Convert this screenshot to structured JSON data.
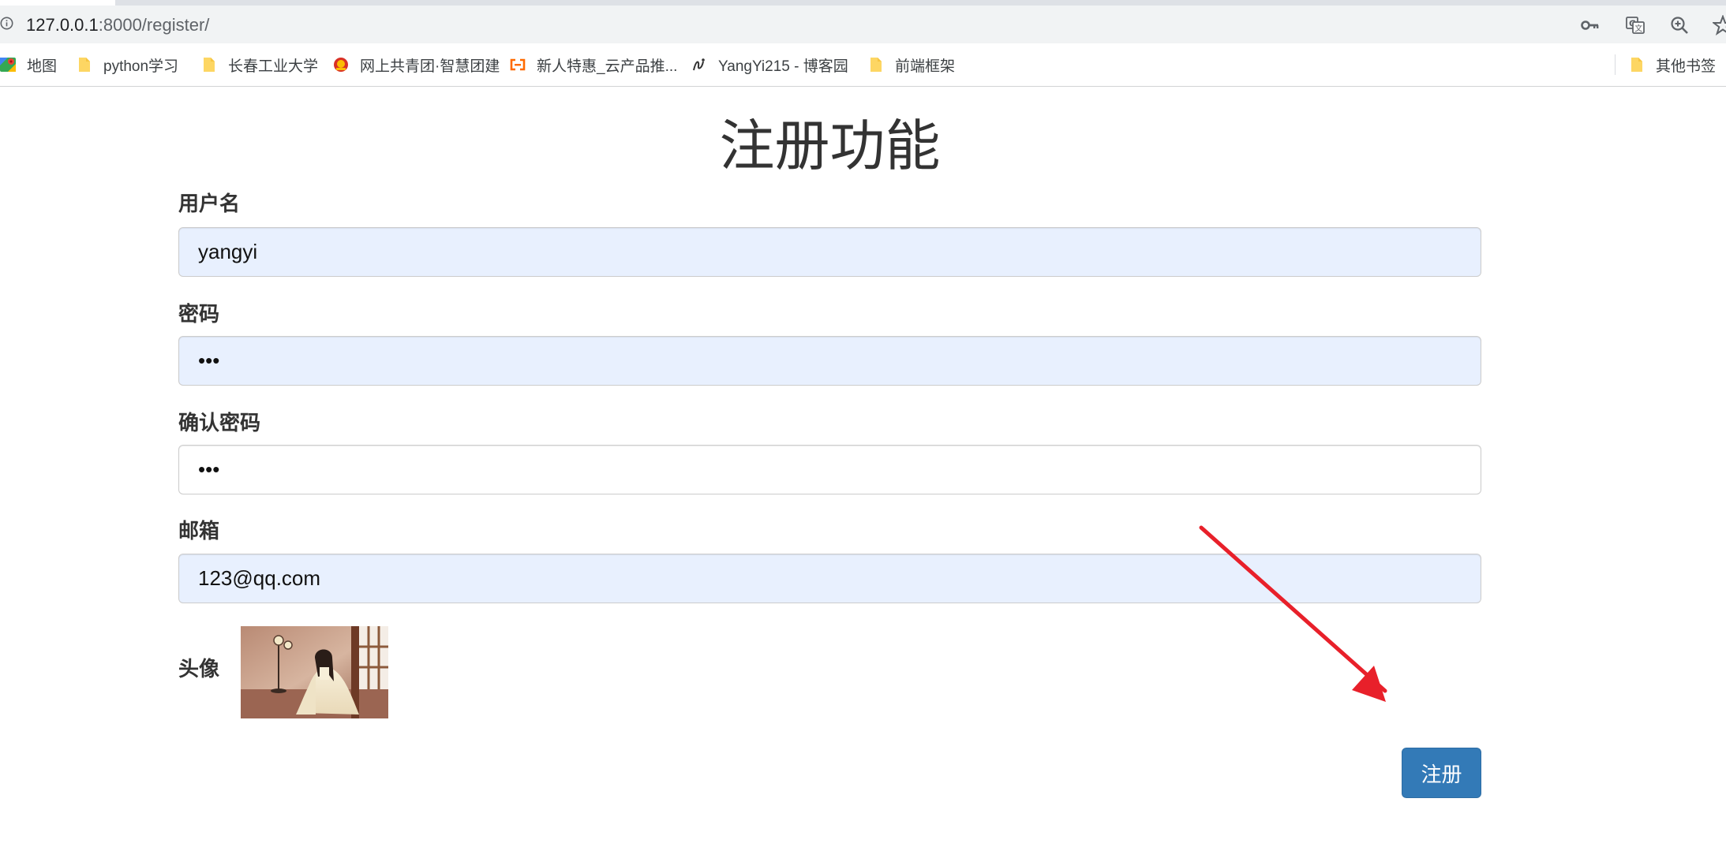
{
  "browser": {
    "url_host": "127.0.0.1",
    "url_rest": ":8000/register/",
    "addressbar_icons": [
      "key-icon",
      "translate-icon",
      "zoom-icon",
      "star-icon"
    ]
  },
  "bookmarks": [
    {
      "label": "地图",
      "icon": "maps-icon"
    },
    {
      "label": "python学习",
      "icon": "folder-icon"
    },
    {
      "label": "长春工业大学",
      "icon": "folder-icon"
    },
    {
      "label": "网上共青团·智慧团建",
      "icon": "youth-league-icon"
    },
    {
      "label": "新人特惠_云产品推...",
      "icon": "aliyun-icon"
    },
    {
      "label": "YangYi215 - 博客园",
      "icon": "cnblogs-icon"
    },
    {
      "label": "前端框架",
      "icon": "folder-icon"
    },
    {
      "label": "其他书签",
      "icon": "folder-icon"
    }
  ],
  "form": {
    "title": "注册功能",
    "username_label": "用户名",
    "username_value": "yangyi",
    "password_label": "密码",
    "password_value": "•••",
    "confirm_label": "确认密码",
    "confirm_value": "•••",
    "email_label": "邮箱",
    "email_value": "123@qq.com",
    "avatar_label": "头像",
    "submit_label": "注册"
  },
  "colors": {
    "primary_button": "#337ab7",
    "autofill_background": "#e8f0fe",
    "annotation_arrow": "#e8202a",
    "folder_yellow": "#fdd663"
  }
}
